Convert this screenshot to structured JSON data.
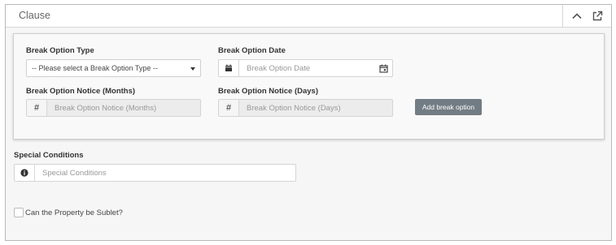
{
  "panel": {
    "title": "Clause"
  },
  "icons": {
    "collapse": "chevron-up-icon",
    "popout": "external-link-icon",
    "calendar_left": "calendar-icon",
    "calendar_right": "calendar-picker-icon",
    "hash": "hash-icon",
    "info": "info-circle-icon"
  },
  "break_option": {
    "type_label": "Break Option Type",
    "type_selected": "-- Please select a Break Option Type --",
    "date_label": "Break Option Date",
    "date_placeholder": "Break Option Date",
    "notice_months_label": "Break Option Notice (Months)",
    "notice_months_placeholder": "Break Option Notice (Months)",
    "notice_days_label": "Break Option Notice (Days)",
    "notice_days_placeholder": "Break Option Notice (Days)",
    "hash_symbol": "#",
    "add_button": "Add break option"
  },
  "special_conditions": {
    "label": "Special Conditions",
    "placeholder": "Special Conditions"
  },
  "sublet": {
    "label": "Can the Property be Sublet?",
    "checked": false
  },
  "colors": {
    "button_bg": "#727c84",
    "border": "#b9b9b9",
    "panel_bg": "#f6f6f6"
  }
}
